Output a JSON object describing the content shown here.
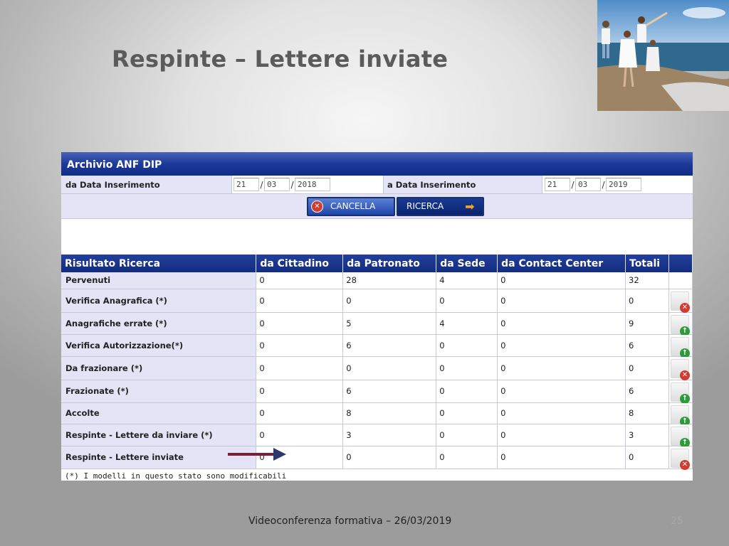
{
  "slide": {
    "title": "Respinte – Lettere inviate",
    "footer": "Videoconferenza formativa – 26/03/2019",
    "number": "25"
  },
  "panel": {
    "title": "Archivio ANF DIP",
    "from_label": "da Data Inserimento",
    "from_date": {
      "day": "21",
      "month": "03",
      "year": "2018"
    },
    "to_label": "a Data Inserimento",
    "to_date": {
      "day": "21",
      "month": "03",
      "year": "2019"
    },
    "date_separator": "/",
    "cancel_label": "CANCELLA",
    "search_label": "RICERCA",
    "colors": {
      "header": "#1d3a99",
      "label_bg": "#e4e4f6",
      "delete": "#d23b2e",
      "enable": "#2e9a3a"
    }
  },
  "results": {
    "headers": [
      "Risultato Ricerca",
      "da Cittadino",
      "da Patronato",
      "da Sede",
      "da Contact Center",
      "Totali"
    ],
    "rows": [
      {
        "label": "Pervenuti",
        "values": [
          "0",
          "28",
          "4",
          "0",
          "32"
        ],
        "action": "none"
      },
      {
        "label": "Verifica Anagrafica (*)",
        "values": [
          "0",
          "0",
          "0",
          "0",
          "0"
        ],
        "action": "delete-icon"
      },
      {
        "label": "Anagrafiche errate (*)",
        "values": [
          "0",
          "5",
          "4",
          "0",
          "9"
        ],
        "action": "add-icon"
      },
      {
        "label": "Verifica Autorizzazione(*)",
        "values": [
          "0",
          "6",
          "0",
          "0",
          "6"
        ],
        "action": "add-icon"
      },
      {
        "label": "Da frazionare (*)",
        "values": [
          "0",
          "0",
          "0",
          "0",
          "0"
        ],
        "action": "delete-icon"
      },
      {
        "label": "Frazionate (*)",
        "values": [
          "0",
          "6",
          "0",
          "0",
          "6"
        ],
        "action": "add-icon"
      },
      {
        "label": "Accolte",
        "values": [
          "0",
          "8",
          "0",
          "0",
          "8"
        ],
        "action": "add-icon"
      },
      {
        "label": "Respinte - Lettere da inviare (*)",
        "values": [
          "0",
          "3",
          "0",
          "0",
          "3"
        ],
        "action": "add-icon"
      },
      {
        "label": "Respinte - Lettere inviate",
        "values": [
          "0",
          "0",
          "0",
          "0",
          "0"
        ],
        "action": "delete-icon"
      }
    ],
    "note": "(*) I modelli in questo stato sono modificabili"
  }
}
